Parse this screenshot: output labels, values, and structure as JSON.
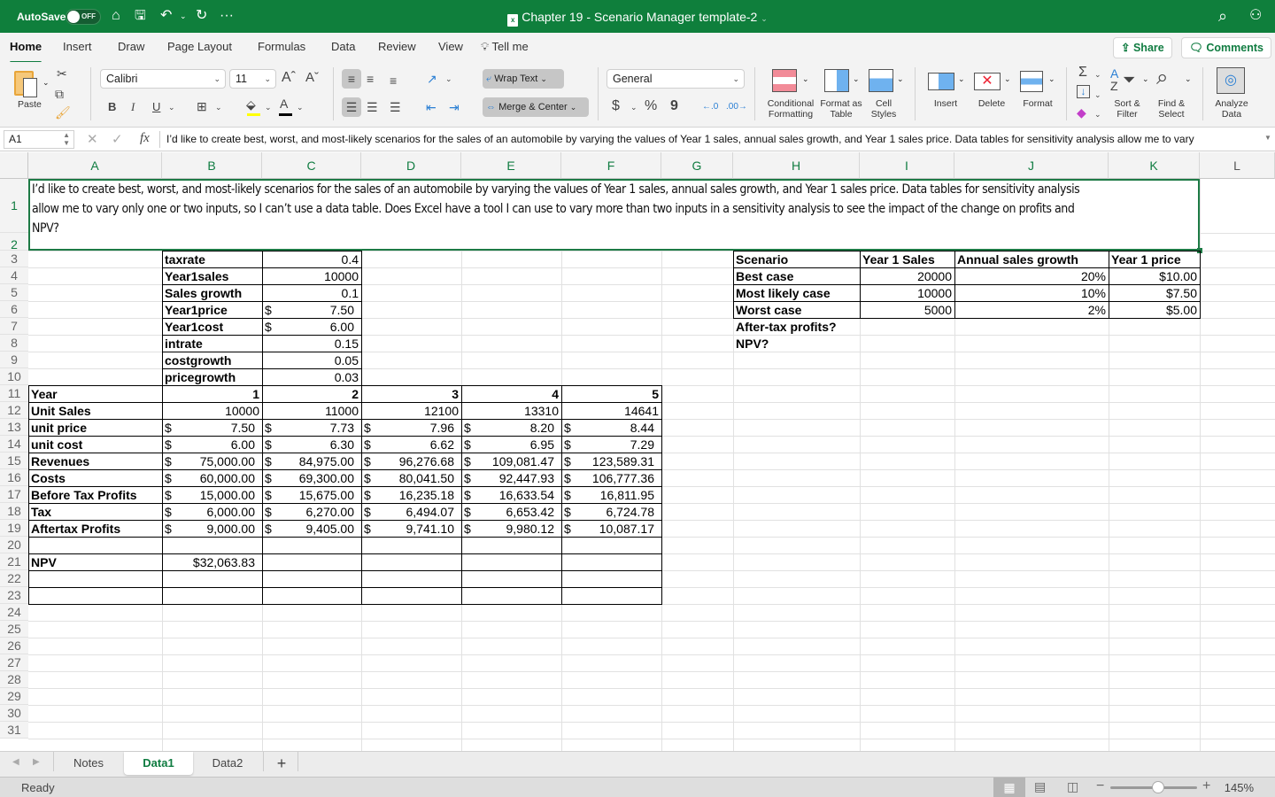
{
  "titlebar": {
    "autosave_label": "AutoSave",
    "autosave_state": "OFF",
    "doc_title": "Chapter 19 - Scenario Manager template-2",
    "file_badge": "x"
  },
  "menu": {
    "tabs": [
      "Home",
      "Insert",
      "Draw",
      "Page Layout",
      "Formulas",
      "Data",
      "Review",
      "View"
    ],
    "active_tab": "Home",
    "tell_me": "Tell me",
    "share": "Share",
    "comments": "Comments"
  },
  "ribbon": {
    "paste": "Paste",
    "font_name": "Calibri",
    "font_size": "11",
    "bold": "B",
    "italic": "I",
    "underline": "U",
    "wrap_text": "Wrap Text",
    "merge_center": "Merge & Center",
    "number_format": "General",
    "currency": "$",
    "percent": "%",
    "comma": "9",
    "conditional_formatting": "Conditional Formatting",
    "format_as_table": "Format as Table",
    "cell_styles": "Cell Styles",
    "insert": "Insert",
    "delete": "Delete",
    "format": "Format",
    "sort_filter": "Sort & Filter",
    "find_select": "Find & Select",
    "analyze_data": "Analyze Data",
    "highlight_color": "#ffff00",
    "font_color": "#000000"
  },
  "formula_bar": {
    "name_box": "A1",
    "fx": "fx",
    "content": "I’d like to create best, worst, and most-likely scenarios for the sales of an automobile by varying the values of Year 1 sales, annual sales growth, and Year 1 sales price. Data tables for sensitivity analysis allow me to vary"
  },
  "grid": {
    "columns": [
      "A",
      "B",
      "C",
      "D",
      "E",
      "F",
      "G",
      "H",
      "I",
      "J",
      "K",
      "L"
    ],
    "rows": [
      "1",
      "2",
      "3",
      "4",
      "5",
      "6",
      "7",
      "8",
      "9",
      "10",
      "11",
      "12",
      "13",
      "14",
      "15",
      "16",
      "17",
      "18",
      "19",
      "20",
      "21",
      "22",
      "23",
      "24",
      "25",
      "26",
      "27",
      "28",
      "29",
      "30",
      "31"
    ],
    "a1_lines": [
      "I’d like to create best, worst, and most-likely scenarios for the sales of an automobile by varying the values of Year 1 sales, annual sales growth, and Year 1 sales price. Data tables for sensitivity analysis",
      "allow me to vary only one or two inputs, so I can’t use a data table. Does Excel have a tool I can use to vary more than two inputs in a sensitivity analysis to see the impact of the change on profits and",
      "NPV?"
    ],
    "inputs": [
      {
        "label": "taxrate",
        "cur": "",
        "value": "0.4"
      },
      {
        "label": "Year1sales",
        "cur": "",
        "value": "10000"
      },
      {
        "label": "Sales growth",
        "cur": "",
        "value": "0.1"
      },
      {
        "label": "Year1price",
        "cur": "$",
        "value": "7.50"
      },
      {
        "label": "Year1cost",
        "cur": "$",
        "value": "6.00"
      },
      {
        "label": "intrate",
        "cur": "",
        "value": "0.15"
      },
      {
        "label": "costgrowth",
        "cur": "",
        "value": "0.05"
      },
      {
        "label": "pricegrowth",
        "cur": "",
        "value": "0.03"
      }
    ],
    "model": {
      "year_label": "Year",
      "years": [
        "1",
        "2",
        "3",
        "4",
        "5"
      ],
      "rows": [
        {
          "label": "Unit Sales",
          "cur": false,
          "values": [
            "10000",
            "11000",
            "12100",
            "13310",
            "14641"
          ]
        },
        {
          "label": "unit price",
          "cur": true,
          "values": [
            "7.50",
            "7.73",
            "7.96",
            "8.20",
            "8.44"
          ]
        },
        {
          "label": "unit cost",
          "cur": true,
          "values": [
            "6.00",
            "6.30",
            "6.62",
            "6.95",
            "7.29"
          ]
        },
        {
          "label": "Revenues",
          "cur": true,
          "values": [
            "75,000.00",
            "84,975.00",
            "96,276.68",
            "109,081.47",
            "123,589.31"
          ]
        },
        {
          "label": "Costs",
          "cur": true,
          "values": [
            "60,000.00",
            "69,300.00",
            "80,041.50",
            "92,447.93",
            "106,777.36"
          ]
        },
        {
          "label": "Before Tax Profits",
          "cur": true,
          "values": [
            "15,000.00",
            "15,675.00",
            "16,235.18",
            "16,633.54",
            "16,811.95"
          ]
        },
        {
          "label": "Tax",
          "cur": true,
          "values": [
            "6,000.00",
            "6,270.00",
            "6,494.07",
            "6,653.42",
            "6,724.78"
          ]
        },
        {
          "label": "Aftertax Profits",
          "cur": true,
          "values": [
            "9,000.00",
            "9,405.00",
            "9,741.10",
            "9,980.12",
            "10,087.17"
          ]
        }
      ],
      "npv_label": "NPV",
      "npv_value": "$32,063.83"
    },
    "scenarios": {
      "headers": [
        "Scenario",
        "Year 1 Sales",
        "Annual sales growth",
        "Year 1 price"
      ],
      "rows": [
        [
          "Best case",
          "20000",
          "20%",
          "$10.00"
        ],
        [
          "Most likely case",
          "10000",
          "10%",
          "$7.50"
        ],
        [
          "Worst case",
          "5000",
          "2%",
          "$5.00"
        ]
      ],
      "questions": [
        "After-tax profits?",
        "NPV?"
      ]
    }
  },
  "sheet_tabs": {
    "tabs": [
      "Notes",
      "Data1",
      "Data2"
    ],
    "active": "Data1",
    "add": "+"
  },
  "status": {
    "text": "Ready",
    "zoom": "145%",
    "zoom_level_fraction": 0.55
  }
}
